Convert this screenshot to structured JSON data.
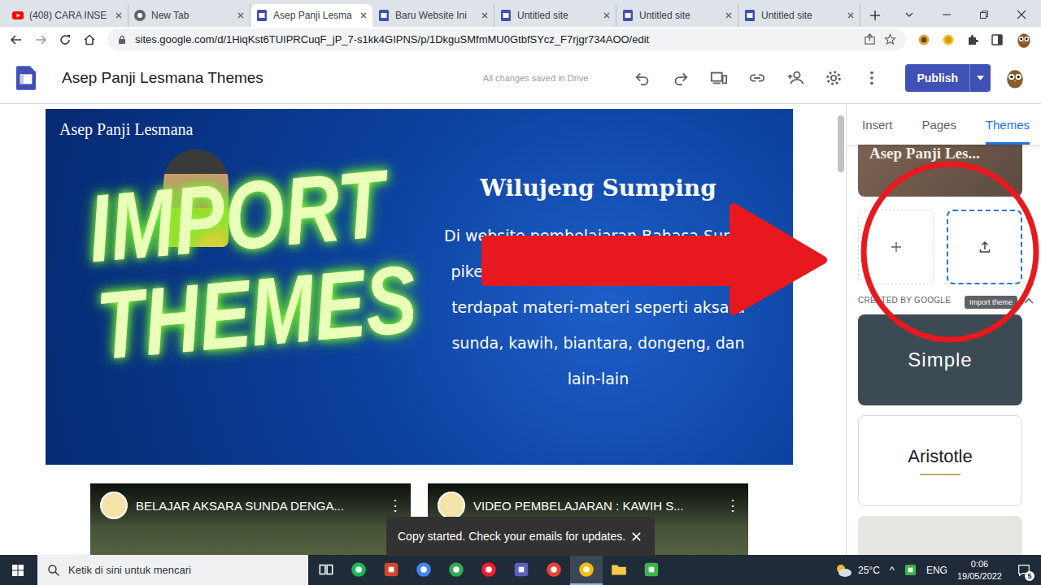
{
  "browser": {
    "tabs": [
      {
        "label": "(408) CARA INSE",
        "kind": "youtube",
        "selected": false
      },
      {
        "label": "New Tab",
        "kind": "chrome",
        "selected": false
      },
      {
        "label": "Asep Panji Lesma",
        "kind": "sites",
        "selected": true
      },
      {
        "label": "Baru Website Ini",
        "kind": "sites",
        "selected": false
      },
      {
        "label": "Untitled site",
        "kind": "sites",
        "selected": false
      },
      {
        "label": "Untitled site",
        "kind": "sites",
        "selected": false
      },
      {
        "label": "Untitled site",
        "kind": "sites",
        "selected": false
      }
    ],
    "url": "sites.google.com/d/1HiqKst6TUIPRCuqF_jP_7-s1kk4GIPNS/p/1DkguSMfmMU0GtbfSYcz_F7rjgr734AOO/edit"
  },
  "editor": {
    "site_title": "Asep Panji Lesmana Themes",
    "save_status": "All changes saved in Drive",
    "publish_button": "Publish"
  },
  "page": {
    "hero": {
      "site_name": "Asep Panji Lesmana",
      "heading": "Wilujeng Sumping",
      "lines": [
        "Di website pembelajaran Bahasa Sunda",
        "pikeun murid SMP. Di dlam website ini",
        "terdapat materi-materi seperti aksara",
        "sunda, kawih, biantara, dongeng, dan",
        "lain-lain"
      ]
    },
    "videos": [
      {
        "title": "BELAJAR AKSARA SUNDA DENGA...",
        "menu": "⋮"
      },
      {
        "title": "VIDEO PEMBELAJARAN : KAWIH S...",
        "menu": "⋮"
      }
    ]
  },
  "side_panel": {
    "tabs": [
      {
        "label": "Insert",
        "selected": false
      },
      {
        "label": "Pages",
        "selected": false
      },
      {
        "label": "Themes",
        "selected": true
      }
    ],
    "custom_theme": "Asep Panji Les...",
    "import_tooltip": "Import theme",
    "section_label": "CREATED BY GOOGLE",
    "themes": [
      {
        "name": "Simple",
        "kind": "dark"
      },
      {
        "name": "Aristotle",
        "kind": "light"
      },
      {
        "kind": "partial"
      }
    ]
  },
  "overlay": {
    "lines": [
      "IMPORT",
      "THEMES"
    ]
  },
  "snackbar": {
    "message": "Copy started. Check your emails for updates."
  },
  "taskbar": {
    "search_placeholder": "Ketik di sini untuk mencari",
    "apps": [
      {
        "kind": "taskview",
        "color": "#ffffff",
        "active": false
      },
      {
        "kind": "spotify",
        "color": "#1db954",
        "active": false
      },
      {
        "kind": "powerpoint",
        "color": "#d24726",
        "active": false
      },
      {
        "kind": "chrome",
        "color": "#4285f4",
        "active": false
      },
      {
        "kind": "chrome",
        "color": "#34a853",
        "active": false
      },
      {
        "kind": "opera",
        "color": "#ff1b2d",
        "active": false
      },
      {
        "kind": "app",
        "color": "#5b5fc7",
        "active": false
      },
      {
        "kind": "chrome",
        "color": "#ea4335",
        "active": false
      },
      {
        "kind": "chrome",
        "color": "#fbbc05",
        "active": true
      },
      {
        "kind": "folder",
        "color": "#f8c948",
        "active": false
      },
      {
        "kind": "camtasia",
        "color": "#3cb54a",
        "active": false
      }
    ],
    "temperature": "25°C",
    "tray_chevron": "^",
    "language": "ENG",
    "time": "0:06",
    "date": "19/05/2022",
    "notifications": "5"
  }
}
